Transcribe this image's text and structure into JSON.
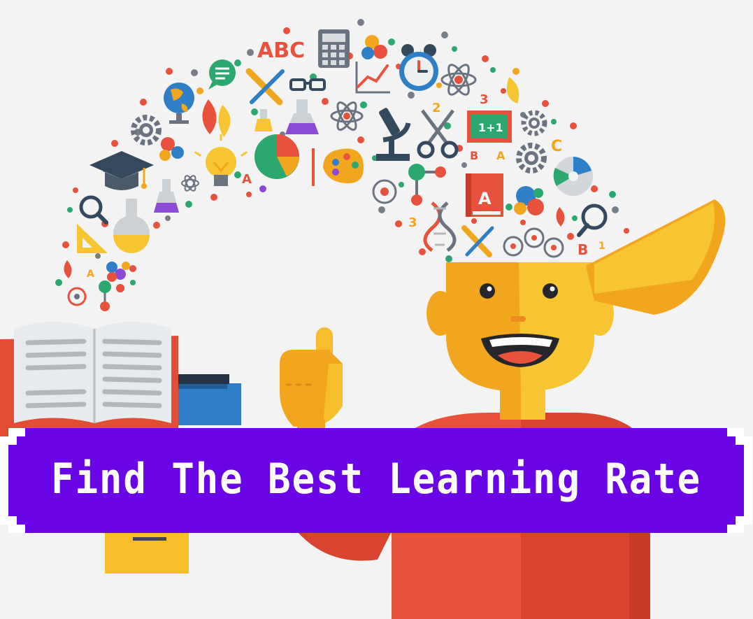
{
  "banner": {
    "title": "Find The Best Learning Rate"
  },
  "doodle_text": {
    "abc": "ABC",
    "calc_1_plus_1": "1+1",
    "letter_a_1": "A",
    "letter_a_2": "A",
    "letter_a_3": "A",
    "letter_b_1": "B",
    "letter_b_2": "B",
    "letter_c": "C",
    "digit_1": "1",
    "digit_2": "2",
    "digit_3a": "3",
    "digit_3b": "3",
    "book_a": "A"
  },
  "colors": {
    "background": "#f3f3f4",
    "banner_fill": "#6a05e6",
    "banner_border": "#ffffff",
    "title_text": "#ffffff",
    "skin": "#f2a61d",
    "skin_light": "#f6c531",
    "shirt": "#e8513c",
    "shirt_dark": "#c83a29"
  }
}
